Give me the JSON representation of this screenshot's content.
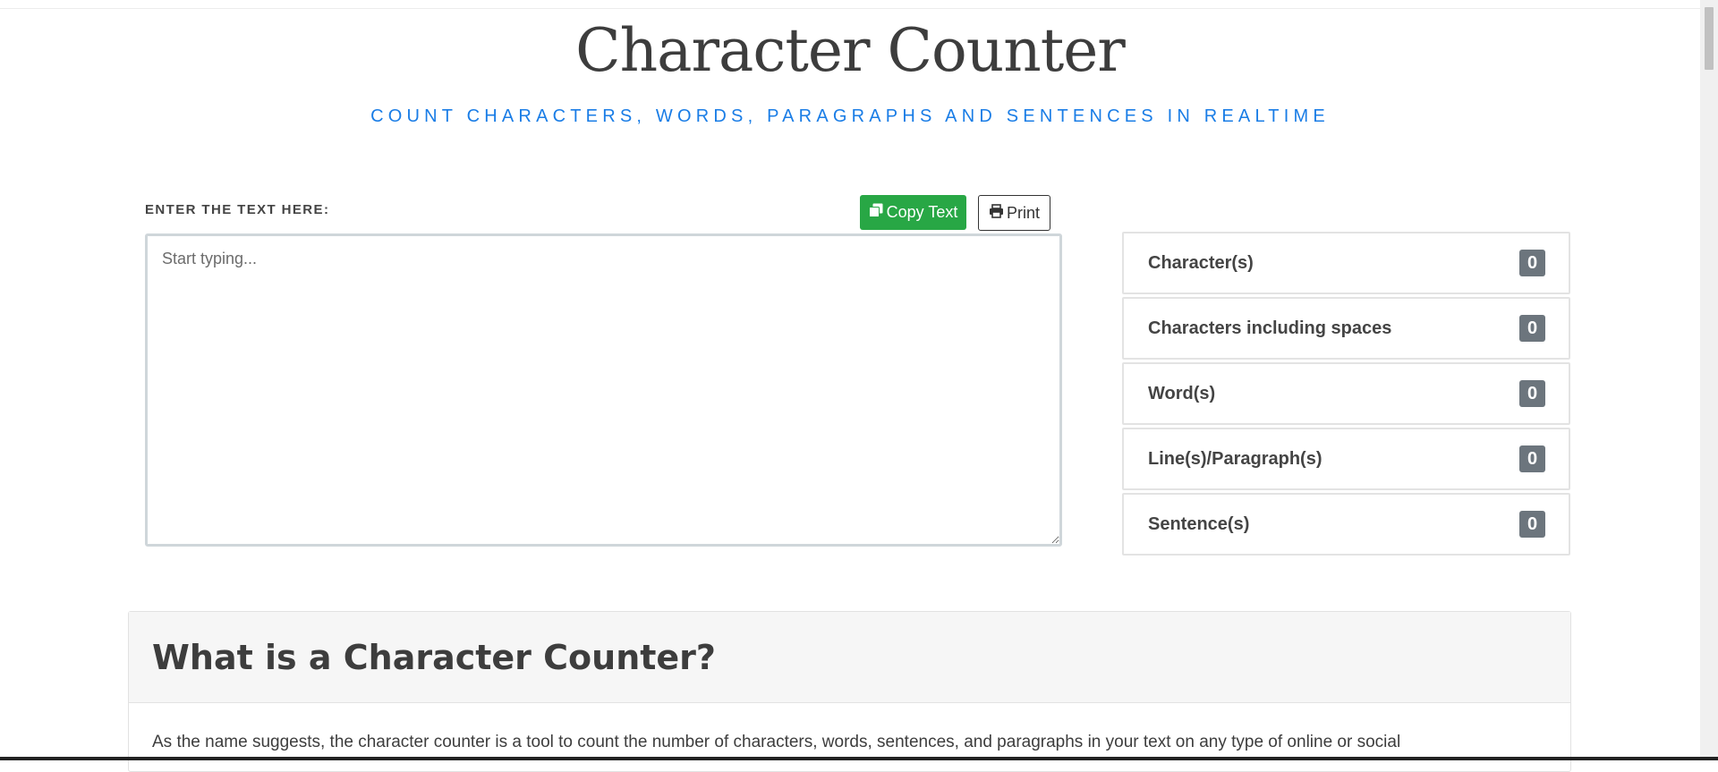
{
  "header": {
    "title": "Character Counter",
    "subtitle": "COUNT CHARACTERS, WORDS, PARAGRAPHS AND SENTENCES IN REALTIME"
  },
  "editor": {
    "label": "ENTER THE TEXT HERE:",
    "placeholder": "Start typing...",
    "value": "",
    "copy_button": "Copy Text",
    "print_button": "Print"
  },
  "stats": [
    {
      "label": "Character(s)",
      "count": "0"
    },
    {
      "label": "Characters including spaces",
      "count": "0"
    },
    {
      "label": "Word(s)",
      "count": "0"
    },
    {
      "label": "Line(s)/Paragraph(s)",
      "count": "0"
    },
    {
      "label": "Sentence(s)",
      "count": "0"
    }
  ],
  "info": {
    "heading": "What is a Character Counter?",
    "body": "As the name suggests, the character counter is a tool to count the number of characters, words, sentences, and paragraphs in your text on any type of online or social"
  },
  "colors": {
    "accent": "#1a7de6",
    "copy_button": "#28a745",
    "badge": "#6c757d"
  },
  "icons": {
    "copy": "copy-icon",
    "print": "print-icon"
  }
}
